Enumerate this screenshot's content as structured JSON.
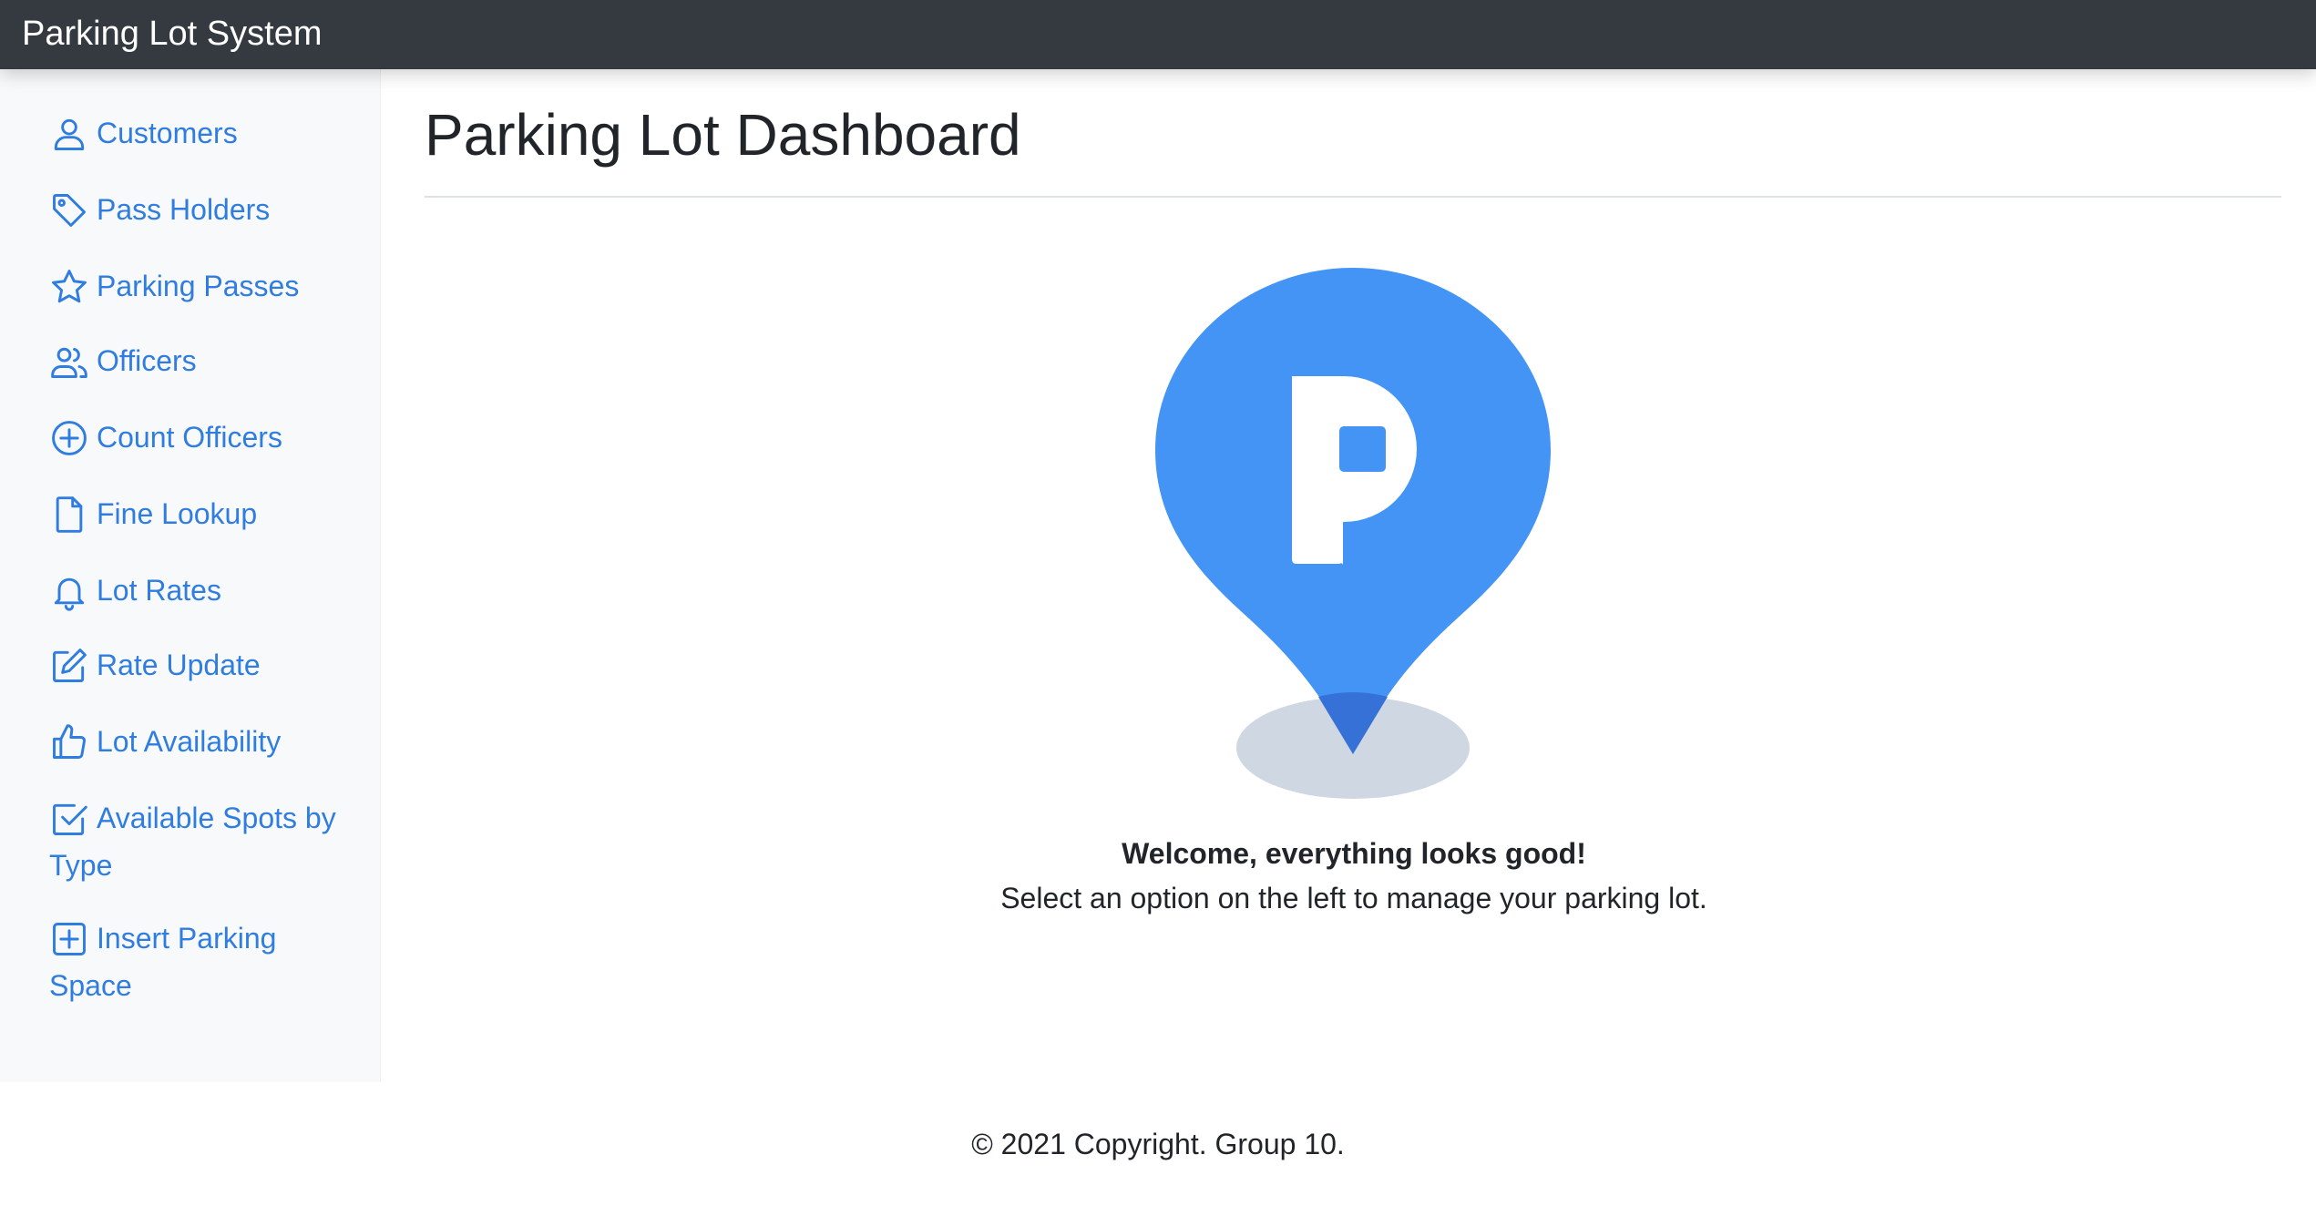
{
  "navbar": {
    "brand": "Parking Lot System"
  },
  "sidebar": {
    "items": [
      {
        "label": "Customers",
        "icon": "person-icon"
      },
      {
        "label": "Pass Holders",
        "icon": "tag-icon"
      },
      {
        "label": "Parking Passes",
        "icon": "star-icon"
      },
      {
        "label": "Officers",
        "icon": "people-icon"
      },
      {
        "label": "Count Officers",
        "icon": "plus-circle-icon"
      },
      {
        "label": "Fine Lookup",
        "icon": "file-icon"
      },
      {
        "label": "Lot Rates",
        "icon": "bell-icon"
      },
      {
        "label": "Rate Update",
        "icon": "pencil-square-icon"
      },
      {
        "label": "Lot Availability",
        "icon": "thumbs-up-icon"
      },
      {
        "label": "Available Spots by Type",
        "icon": "check-square-icon"
      },
      {
        "label": "Insert Parking Space",
        "icon": "plus-square-icon"
      }
    ]
  },
  "main": {
    "title": "Parking Lot Dashboard",
    "hero": {
      "letter": "P",
      "icon": "parking-pin-icon"
    },
    "welcome_title": "Welcome, everything looks good!",
    "welcome_text": "Select an option on the left to manage your parking lot."
  },
  "footer": {
    "text": "© 2021 Copyright. Group 10."
  },
  "colors": {
    "navbar_bg": "#343a40",
    "link": "#2f7de1",
    "sidebar_bg": "#f8f9fa",
    "pin": "#4394f5",
    "pin_tip": "#3671d8",
    "shadow": "#cfd8e2"
  }
}
